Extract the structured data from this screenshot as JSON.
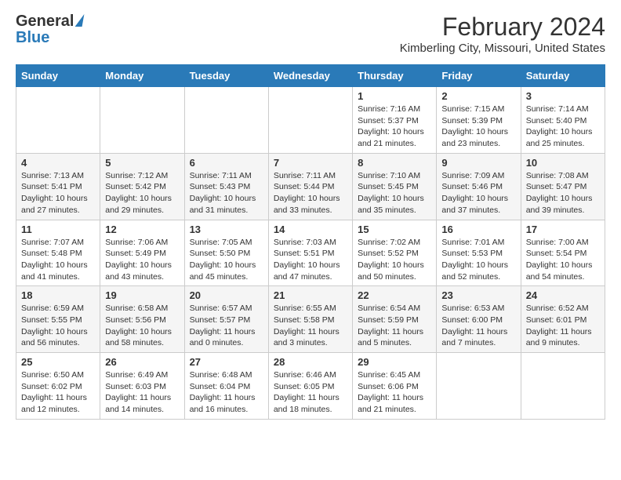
{
  "header": {
    "logo_general": "General",
    "logo_blue": "Blue",
    "month": "February 2024",
    "location": "Kimberling City, Missouri, United States"
  },
  "days_of_week": [
    "Sunday",
    "Monday",
    "Tuesday",
    "Wednesday",
    "Thursday",
    "Friday",
    "Saturday"
  ],
  "weeks": [
    [
      {
        "day": "",
        "text": ""
      },
      {
        "day": "",
        "text": ""
      },
      {
        "day": "",
        "text": ""
      },
      {
        "day": "",
        "text": ""
      },
      {
        "day": "1",
        "text": "Sunrise: 7:16 AM\nSunset: 5:37 PM\nDaylight: 10 hours and 21 minutes."
      },
      {
        "day": "2",
        "text": "Sunrise: 7:15 AM\nSunset: 5:39 PM\nDaylight: 10 hours and 23 minutes."
      },
      {
        "day": "3",
        "text": "Sunrise: 7:14 AM\nSunset: 5:40 PM\nDaylight: 10 hours and 25 minutes."
      }
    ],
    [
      {
        "day": "4",
        "text": "Sunrise: 7:13 AM\nSunset: 5:41 PM\nDaylight: 10 hours and 27 minutes."
      },
      {
        "day": "5",
        "text": "Sunrise: 7:12 AM\nSunset: 5:42 PM\nDaylight: 10 hours and 29 minutes."
      },
      {
        "day": "6",
        "text": "Sunrise: 7:11 AM\nSunset: 5:43 PM\nDaylight: 10 hours and 31 minutes."
      },
      {
        "day": "7",
        "text": "Sunrise: 7:11 AM\nSunset: 5:44 PM\nDaylight: 10 hours and 33 minutes."
      },
      {
        "day": "8",
        "text": "Sunrise: 7:10 AM\nSunset: 5:45 PM\nDaylight: 10 hours and 35 minutes."
      },
      {
        "day": "9",
        "text": "Sunrise: 7:09 AM\nSunset: 5:46 PM\nDaylight: 10 hours and 37 minutes."
      },
      {
        "day": "10",
        "text": "Sunrise: 7:08 AM\nSunset: 5:47 PM\nDaylight: 10 hours and 39 minutes."
      }
    ],
    [
      {
        "day": "11",
        "text": "Sunrise: 7:07 AM\nSunset: 5:48 PM\nDaylight: 10 hours and 41 minutes."
      },
      {
        "day": "12",
        "text": "Sunrise: 7:06 AM\nSunset: 5:49 PM\nDaylight: 10 hours and 43 minutes."
      },
      {
        "day": "13",
        "text": "Sunrise: 7:05 AM\nSunset: 5:50 PM\nDaylight: 10 hours and 45 minutes."
      },
      {
        "day": "14",
        "text": "Sunrise: 7:03 AM\nSunset: 5:51 PM\nDaylight: 10 hours and 47 minutes."
      },
      {
        "day": "15",
        "text": "Sunrise: 7:02 AM\nSunset: 5:52 PM\nDaylight: 10 hours and 50 minutes."
      },
      {
        "day": "16",
        "text": "Sunrise: 7:01 AM\nSunset: 5:53 PM\nDaylight: 10 hours and 52 minutes."
      },
      {
        "day": "17",
        "text": "Sunrise: 7:00 AM\nSunset: 5:54 PM\nDaylight: 10 hours and 54 minutes."
      }
    ],
    [
      {
        "day": "18",
        "text": "Sunrise: 6:59 AM\nSunset: 5:55 PM\nDaylight: 10 hours and 56 minutes."
      },
      {
        "day": "19",
        "text": "Sunrise: 6:58 AM\nSunset: 5:56 PM\nDaylight: 10 hours and 58 minutes."
      },
      {
        "day": "20",
        "text": "Sunrise: 6:57 AM\nSunset: 5:57 PM\nDaylight: 11 hours and 0 minutes."
      },
      {
        "day": "21",
        "text": "Sunrise: 6:55 AM\nSunset: 5:58 PM\nDaylight: 11 hours and 3 minutes."
      },
      {
        "day": "22",
        "text": "Sunrise: 6:54 AM\nSunset: 5:59 PM\nDaylight: 11 hours and 5 minutes."
      },
      {
        "day": "23",
        "text": "Sunrise: 6:53 AM\nSunset: 6:00 PM\nDaylight: 11 hours and 7 minutes."
      },
      {
        "day": "24",
        "text": "Sunrise: 6:52 AM\nSunset: 6:01 PM\nDaylight: 11 hours and 9 minutes."
      }
    ],
    [
      {
        "day": "25",
        "text": "Sunrise: 6:50 AM\nSunset: 6:02 PM\nDaylight: 11 hours and 12 minutes."
      },
      {
        "day": "26",
        "text": "Sunrise: 6:49 AM\nSunset: 6:03 PM\nDaylight: 11 hours and 14 minutes."
      },
      {
        "day": "27",
        "text": "Sunrise: 6:48 AM\nSunset: 6:04 PM\nDaylight: 11 hours and 16 minutes."
      },
      {
        "day": "28",
        "text": "Sunrise: 6:46 AM\nSunset: 6:05 PM\nDaylight: 11 hours and 18 minutes."
      },
      {
        "day": "29",
        "text": "Sunrise: 6:45 AM\nSunset: 6:06 PM\nDaylight: 11 hours and 21 minutes."
      },
      {
        "day": "",
        "text": ""
      },
      {
        "day": "",
        "text": ""
      }
    ]
  ]
}
